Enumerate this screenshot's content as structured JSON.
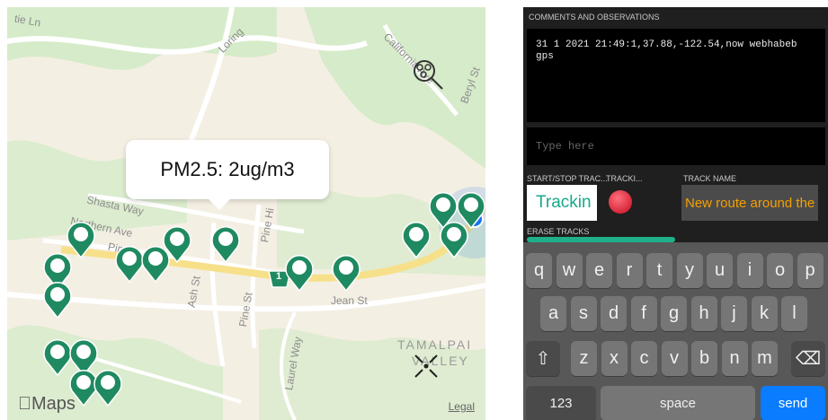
{
  "map": {
    "streets": [
      "tie Ln",
      "Loring",
      "California Ave",
      "Beryl St",
      "Shasta Way",
      "Northern Ave",
      "Pine",
      "Pine Hi",
      "Ash St",
      "Pine St",
      "Jean St",
      "Laurel Way",
      "ve"
    ],
    "area": [
      "TAMALPAI",
      "VALLEY"
    ],
    "tooltip": "PM2.5:   2ug/m3",
    "route_shield": "1",
    "brand": "Maps",
    "legal": "Legal",
    "colors": {
      "pin": "#1f8a61",
      "land": "#f4efe3",
      "park": "#d6ebc9",
      "road": "#ffffff",
      "highway": "#f7e08a",
      "location": "#1572f0"
    }
  },
  "phone": {
    "comments_label": "COMMENTS AND OBSERVATIONS",
    "comments_text": "31 1 2021 21:49:1,37.88,-122.54,now webhabeb gps",
    "type_placeholder": "Type here",
    "start_stop_label": "START/STOP TRAC...",
    "tracki_label": "TRACKI...",
    "track_name_label": "TRACK NAME",
    "tracking_button": "Trackin",
    "track_name_value": "New route around the",
    "erase_label": "ERASE TRACKS",
    "keyboard": {
      "row1": [
        "q",
        "w",
        "e",
        "r",
        "t",
        "y",
        "u",
        "i",
        "o",
        "p"
      ],
      "row2": [
        "a",
        "s",
        "d",
        "f",
        "g",
        "h",
        "j",
        "k",
        "l"
      ],
      "row3": [
        "z",
        "x",
        "c",
        "v",
        "b",
        "n",
        "m"
      ],
      "shift": "⇧",
      "delete": "⌫",
      "numbers": "123",
      "space": "space",
      "send": "send"
    },
    "colors": {
      "accent": "#1db08a",
      "track_text": "#f5a000",
      "send": "#0a7cff",
      "led": "#d6283a"
    }
  }
}
